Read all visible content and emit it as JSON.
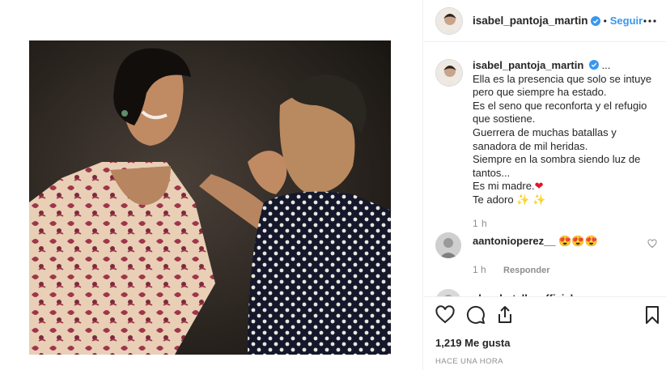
{
  "post": {
    "username": "isabel_pantoja_martin",
    "follow_label": "Seguir",
    "dot": "•",
    "ellipsis": "...",
    "caption_lines": [
      "Ella es la presencia que solo se intuye pero que siempre ha estado.",
      "Es el seno que reconforta y el refugio que sostiene.",
      "Guerrera de muchas batallas y sanadora de mil heridas.",
      "Siempre en la sombra siendo luz de tantos...",
      "Es mi madre.",
      "Te adoro"
    ],
    "heart_emoji": "❤",
    "sparkle_emoji": "✨ ✨",
    "caption_time": "1 h"
  },
  "comments": [
    {
      "username": "aantonioperez__",
      "text": "😍😍😍",
      "time": "1 h",
      "reply_label": "Responder"
    },
    {
      "username": "churrbotella_official"
    }
  ],
  "footer": {
    "likes": "1,219 Me gusta",
    "timestamp": "HACE UNA HORA"
  },
  "colors": {
    "accent": "#3897f0",
    "verified": "#3897f0",
    "heart": "#e0162b"
  }
}
